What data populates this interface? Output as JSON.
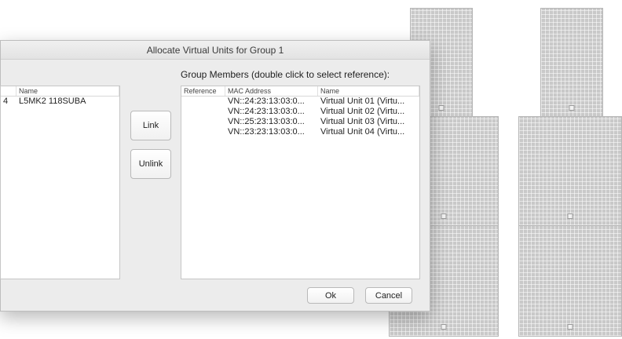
{
  "dialog": {
    "title": "Allocate Virtual Units for Group 1"
  },
  "left_table": {
    "columns": [
      "",
      "Name"
    ],
    "rows": [
      {
        "mark": "4",
        "name": "L5MK2 118SUBA"
      }
    ]
  },
  "buttons": {
    "link": "Link",
    "unlink": "Unlink",
    "ok": "Ok",
    "cancel": "Cancel"
  },
  "group_members": {
    "label": "Group Members (double click to select reference):",
    "columns": [
      "Reference",
      "MAC Address",
      "Name"
    ],
    "rows": [
      {
        "reference": "",
        "mac": "VN::24:23:13:03:0...",
        "name": "Virtual Unit 01 (Virtu..."
      },
      {
        "reference": "",
        "mac": "VN::24:23:13:03:0...",
        "name": "Virtual Unit 02 (Virtu..."
      },
      {
        "reference": "",
        "mac": "VN::25:23:13:03:0...",
        "name": "Virtual Unit 03 (Virtu..."
      },
      {
        "reference": "",
        "mac": "VN::23:23:13:03:0...",
        "name": "Virtual Unit 04 (Virtu..."
      }
    ]
  },
  "colors": {
    "dialog_bg": "#ececec",
    "table_bg": "#ffffff",
    "speaker_grey": "#c9c9c9"
  }
}
